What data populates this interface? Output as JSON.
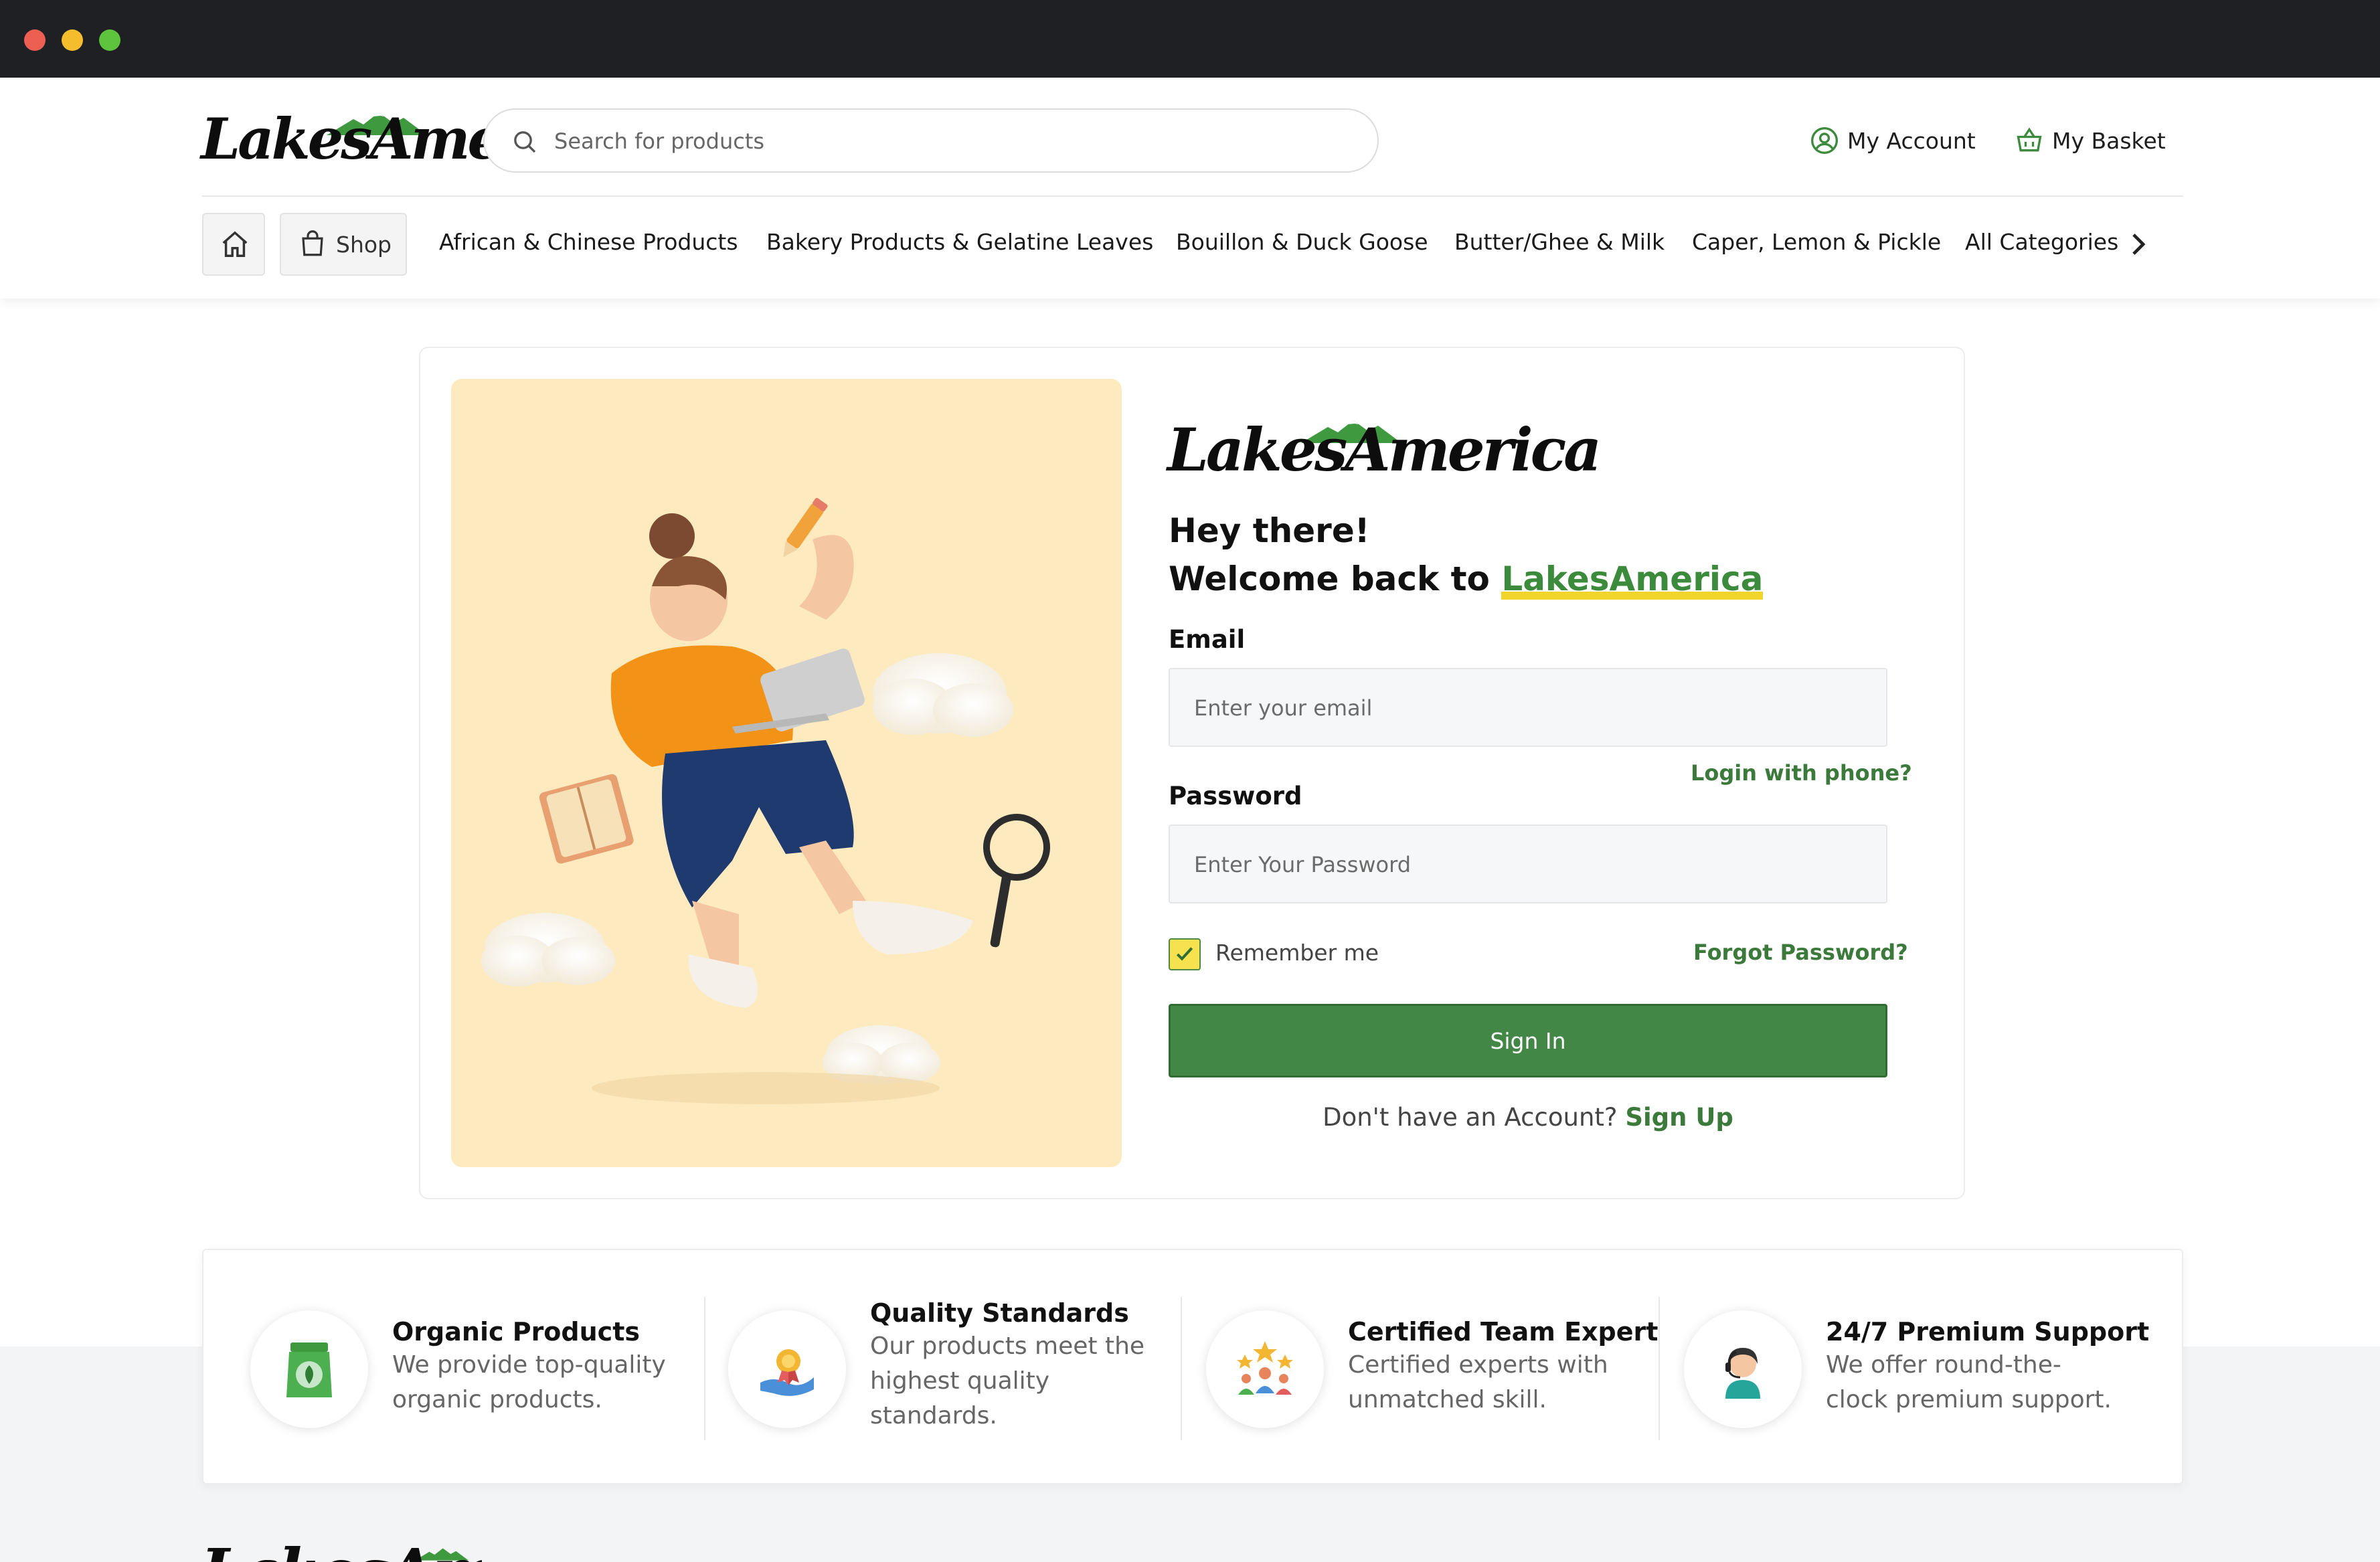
{
  "brand": {
    "name": "LakesAmerica",
    "logo_part1": "Lakes",
    "logo_part2": "America",
    "green": "#3c8a3c",
    "yellow": "#f2d52a"
  },
  "header": {
    "search_placeholder": "Search for products",
    "my_account": "My Account",
    "my_basket": "My Basket"
  },
  "nav": {
    "shop": "Shop",
    "categories": [
      "African & Chinese Products",
      "Bakery Products & Gelatine Leaves",
      "Bouillon & Duck Goose",
      "Butter/Ghee & Milk",
      "Caper, Lemon & Pickle",
      "All Categories"
    ]
  },
  "login": {
    "greeting_line1": "Hey there!",
    "greeting_line2_prefix": "Welcome back to ",
    "greeting_brand": "LakesAmerica",
    "email_label": "Email",
    "email_placeholder": "Enter your email",
    "login_with_phone": "Login with phone?",
    "password_label": "Password",
    "password_placeholder": "Enter Your Password",
    "remember_me": "Remember me",
    "remember_checked": true,
    "forgot_password": "Forgot Password?",
    "sign_in": "Sign In",
    "no_account": "Don't have an Account?",
    "sign_up": "Sign Up"
  },
  "features": [
    {
      "icon": "organic-bag-icon",
      "title": "Organic Products",
      "desc": "We provide top-quality organic products."
    },
    {
      "icon": "quality-award-icon",
      "title": "Quality Standards",
      "desc": "Our products meet the highest quality standards."
    },
    {
      "icon": "certified-team-icon",
      "title": "Certified Team Expert",
      "desc": "Certified experts with unmatched skill."
    },
    {
      "icon": "support-agent-icon",
      "title": "24/7 Premium Support",
      "desc": "We offer round-the-clock premium support."
    }
  ]
}
